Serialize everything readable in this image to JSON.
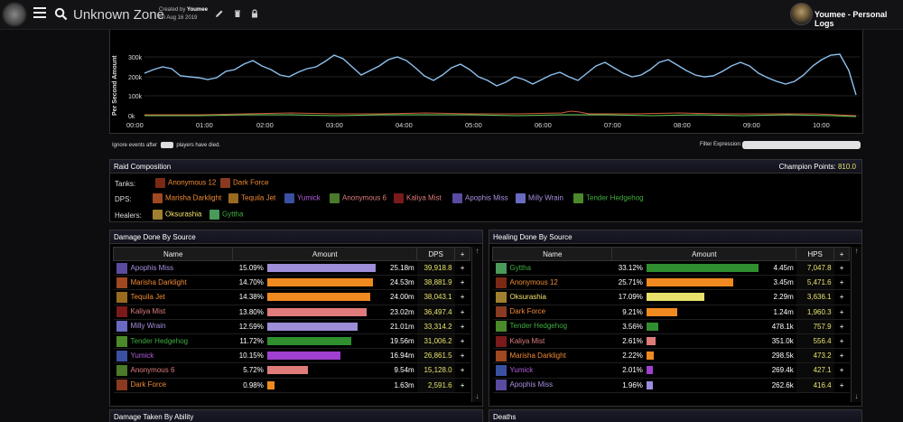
{
  "header": {
    "zone": "Unknown Zone",
    "created_by_prefix": "Created by",
    "created_by_user": "Youmee",
    "date": "Fri Aug 16 2019",
    "user": "Youmee - Personal Logs"
  },
  "graph": {
    "ylabel": "Per Second Amount",
    "yticks": [
      "300k",
      "200k",
      "100k",
      "0k"
    ],
    "xticks": [
      "00:00",
      "01:00",
      "02:00",
      "03:00",
      "04:00",
      "05:00",
      "06:00",
      "07:00",
      "08:00",
      "09:00",
      "10:00"
    ]
  },
  "filters": {
    "ignore_prefix": "Ignore events after",
    "ignore_suffix": "players have died.",
    "filter_label": "Filter Expression:"
  },
  "raid": {
    "title": "Raid Composition",
    "champion_label": "Champion Points:",
    "champion_value": "810.0",
    "tanks_label": "Tanks:",
    "dps_label": "DPS:",
    "healers_label": "Healers:",
    "tanks": [
      {
        "name": "Anonymous 12",
        "color": "#f08a35",
        "icon": "#7a2a14"
      },
      {
        "name": "Dark Force",
        "color": "#f08a35",
        "icon": "#8a3a20"
      }
    ],
    "dps": [
      {
        "name": "Marisha Darklight",
        "color": "#f08a35",
        "icon": "#a04820"
      },
      {
        "name": "Tequila Jet",
        "color": "#f08a35",
        "icon": "#9a6a20"
      },
      {
        "name": "Yumick",
        "color": "#b35fe0",
        "icon": "#3a50a0"
      },
      {
        "name": "Anonymous 6",
        "color": "#e07b7b",
        "icon": "#4a7a2a"
      },
      {
        "name": "Kaliya Mist",
        "color": "#e07b7b",
        "icon": "#7a1a1a"
      },
      {
        "name": "Apophis Miss",
        "color": "#a990e0",
        "icon": "#5a4aa0"
      },
      {
        "name": "Milly Wrain",
        "color": "#a990e0",
        "icon": "#6a6ac0"
      },
      {
        "name": "Tender Hedgehog",
        "color": "#3fae3f",
        "icon": "#4a8a2a"
      }
    ],
    "healers": [
      {
        "name": "Oksurashia",
        "color": "#f3e26b",
        "icon": "#a08030"
      },
      {
        "name": "Gyttha",
        "color": "#3fae3f",
        "icon": "#4a9a5a"
      }
    ]
  },
  "damage_done": {
    "title": "Damage Done By Source",
    "headers": [
      "Name",
      "Amount",
      "DPS",
      "+"
    ],
    "rows": [
      {
        "name": "Apophis Miss",
        "pct": "15.09%",
        "frac": 1.0,
        "bar": "#9e8dd8",
        "amount": "25.18m",
        "rate": "39,918.8",
        "color": "#a990e0",
        "icon": "#5a4aa0"
      },
      {
        "name": "Marisha Darklight",
        "pct": "14.70%",
        "frac": 0.974,
        "bar": "#f08a20",
        "amount": "24.53m",
        "rate": "38,881.9",
        "color": "#f08a35",
        "icon": "#a04820"
      },
      {
        "name": "Tequila Jet",
        "pct": "14.38%",
        "frac": 0.953,
        "bar": "#f08a20",
        "amount": "24.00m",
        "rate": "38,043.1",
        "color": "#f08a35",
        "icon": "#9a6a20"
      },
      {
        "name": "Kaliya Mist",
        "pct": "13.80%",
        "frac": 0.915,
        "bar": "#e07b7b",
        "amount": "23.02m",
        "rate": "36,497.4",
        "color": "#e07b7b",
        "icon": "#7a1a1a"
      },
      {
        "name": "Milly Wrain",
        "pct": "12.59%",
        "frac": 0.834,
        "bar": "#9e8dd8",
        "amount": "21.01m",
        "rate": "33,314.2",
        "color": "#a990e0",
        "icon": "#6a6ac0"
      },
      {
        "name": "Tender Hedgehog",
        "pct": "11.72%",
        "frac": 0.777,
        "bar": "#2f8f2f",
        "amount": "19.56m",
        "rate": "31,006.2",
        "color": "#3fae3f",
        "icon": "#4a8a2a"
      },
      {
        "name": "Yumick",
        "pct": "10.15%",
        "frac": 0.673,
        "bar": "#a040d0",
        "amount": "16.94m",
        "rate": "26,861.5",
        "color": "#b35fe0",
        "icon": "#3a50a0"
      },
      {
        "name": "Anonymous 6",
        "pct": "5.72%",
        "frac": 0.379,
        "bar": "#e07b7b",
        "amount": "9.54m",
        "rate": "15,128.0",
        "color": "#e07b7b",
        "icon": "#4a7a2a"
      },
      {
        "name": "Dark Force",
        "pct": "0.98%",
        "frac": 0.065,
        "bar": "#f08a20",
        "amount": "1.63m",
        "rate": "2,591.6",
        "color": "#f08a35",
        "icon": "#8a3a20"
      }
    ]
  },
  "healing_done": {
    "title": "Healing Done By Source",
    "headers": [
      "Name",
      "Amount",
      "HPS",
      "+"
    ],
    "rows": [
      {
        "name": "Gyttha",
        "pct": "33.12%",
        "frac": 1.0,
        "bar": "#2f8f2f",
        "amount": "4.45m",
        "rate": "7,047.8",
        "color": "#3fae3f",
        "icon": "#4a9a5a"
      },
      {
        "name": "Anonymous 12",
        "pct": "25.71%",
        "frac": 0.776,
        "bar": "#f08a20",
        "amount": "3.45m",
        "rate": "5,471.6",
        "color": "#f08a35",
        "icon": "#7a2a14"
      },
      {
        "name": "Oksurashia",
        "pct": "17.09%",
        "frac": 0.516,
        "bar": "#e6e16b",
        "amount": "2.29m",
        "rate": "3,636.1",
        "color": "#f3e26b",
        "icon": "#a08030"
      },
      {
        "name": "Dark Force",
        "pct": "9.21%",
        "frac": 0.278,
        "bar": "#f08a20",
        "amount": "1.24m",
        "rate": "1,960.3",
        "color": "#f08a35",
        "icon": "#8a3a20"
      },
      {
        "name": "Tender Hedgehog",
        "pct": "3.56%",
        "frac": 0.107,
        "bar": "#2f8f2f",
        "amount": "478.1k",
        "rate": "757.9",
        "color": "#3fae3f",
        "icon": "#4a8a2a"
      },
      {
        "name": "Kaliya Mist",
        "pct": "2.61%",
        "frac": 0.079,
        "bar": "#e07b7b",
        "amount": "351.0k",
        "rate": "556.4",
        "color": "#e07b7b",
        "icon": "#7a1a1a"
      },
      {
        "name": "Marisha Darklight",
        "pct": "2.22%",
        "frac": 0.067,
        "bar": "#f08a20",
        "amount": "298.5k",
        "rate": "473.2",
        "color": "#f08a35",
        "icon": "#a04820"
      },
      {
        "name": "Yumick",
        "pct": "2.01%",
        "frac": 0.061,
        "bar": "#a040d0",
        "amount": "269.4k",
        "rate": "427.1",
        "color": "#b35fe0",
        "icon": "#3a50a0"
      },
      {
        "name": "Apophis Miss",
        "pct": "1.96%",
        "frac": 0.059,
        "bar": "#9e8dd8",
        "amount": "262.6k",
        "rate": "416.4",
        "color": "#a990e0",
        "icon": "#5a4aa0"
      }
    ]
  },
  "bottom": {
    "damage_taken_title": "Damage Taken By Ability",
    "deaths_title": "Deaths"
  }
}
